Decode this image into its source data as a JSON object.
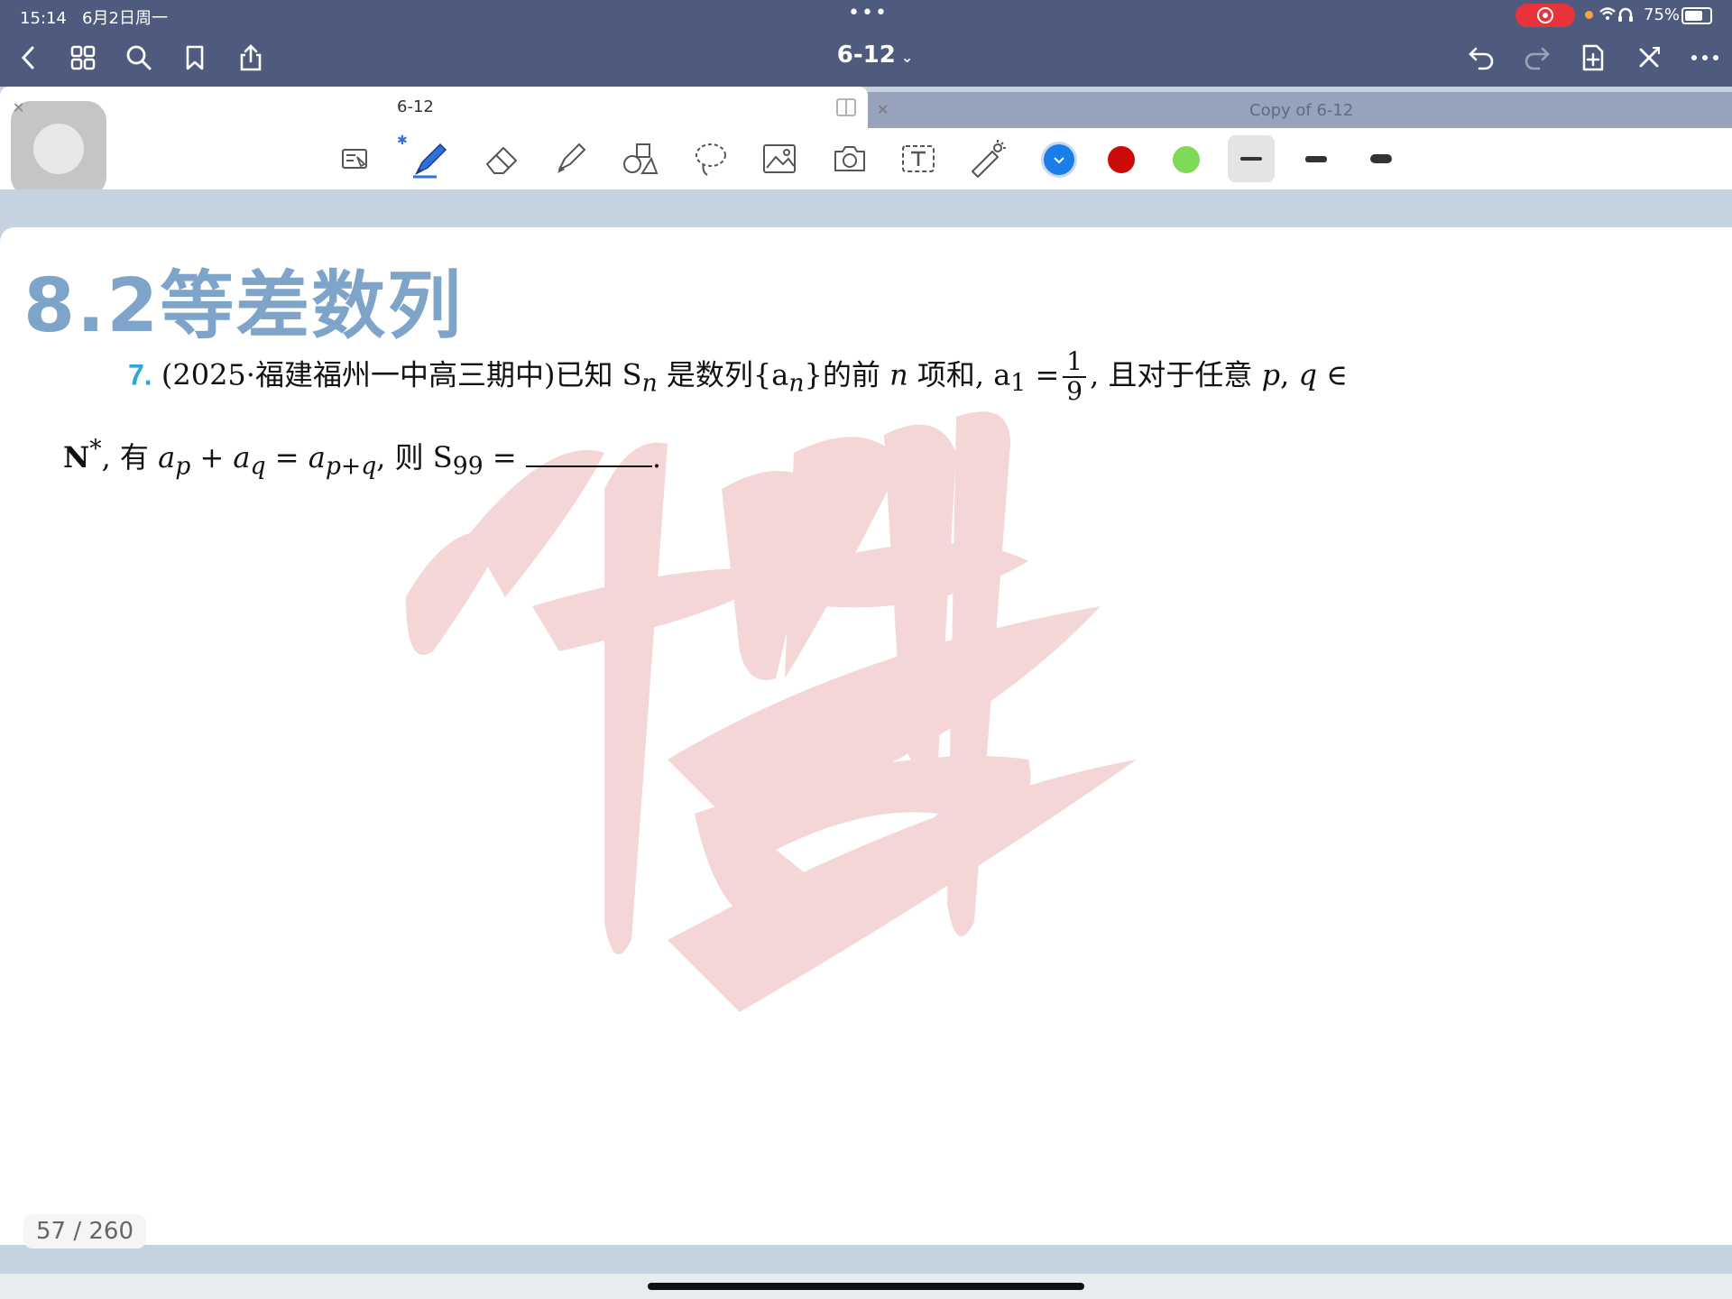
{
  "status_bar": {
    "time": "15:14",
    "date": "6月2日周一",
    "battery": "75%"
  },
  "nav": {
    "document_title": "6-12"
  },
  "tabs": [
    {
      "label": "6-12",
      "active": true
    },
    {
      "label": "Copy of 6-12",
      "active": false
    }
  ],
  "toolbar": {
    "colors": [
      "#1a7ee8",
      "#cc0a0a",
      "#7ed957"
    ],
    "selected_color": "#1a7ee8"
  },
  "page": {
    "section_title": "8.2等差数列",
    "problem": {
      "number": "7.",
      "source": "(2025·福建福州一中高三期中)",
      "line1_a": "已知 S",
      "line1_a_sub": "n",
      "line1_b": " 是数列{a",
      "line1_b_sub": "n",
      "line1_c": "}的前 ",
      "line1_n": "n",
      "line1_d": " 项和, a",
      "line1_d_sub": "1",
      "line1_e": " =",
      "frac_num": "1",
      "frac_den": "9",
      "line1_f": ", 且对于任意 ",
      "line1_p": "p",
      "line1_g": ", ",
      "line1_q": "q",
      "line1_h": " ∈",
      "line2_a": "N",
      "line2_a_sup": "*",
      "line2_b": ", 有 ",
      "line2_ap": "a",
      "line2_ap_sub": "p",
      "line2_c": " + ",
      "line2_aq": "a",
      "line2_aq_sub": "q",
      "line2_d": " = ",
      "line2_apq": "a",
      "line2_apq_sub": "p+q",
      "line2_e": ", 则 S",
      "line2_e_sub": "99",
      "line2_f": " = ",
      "line2_end": "."
    },
    "page_counter": "57 / 260"
  }
}
